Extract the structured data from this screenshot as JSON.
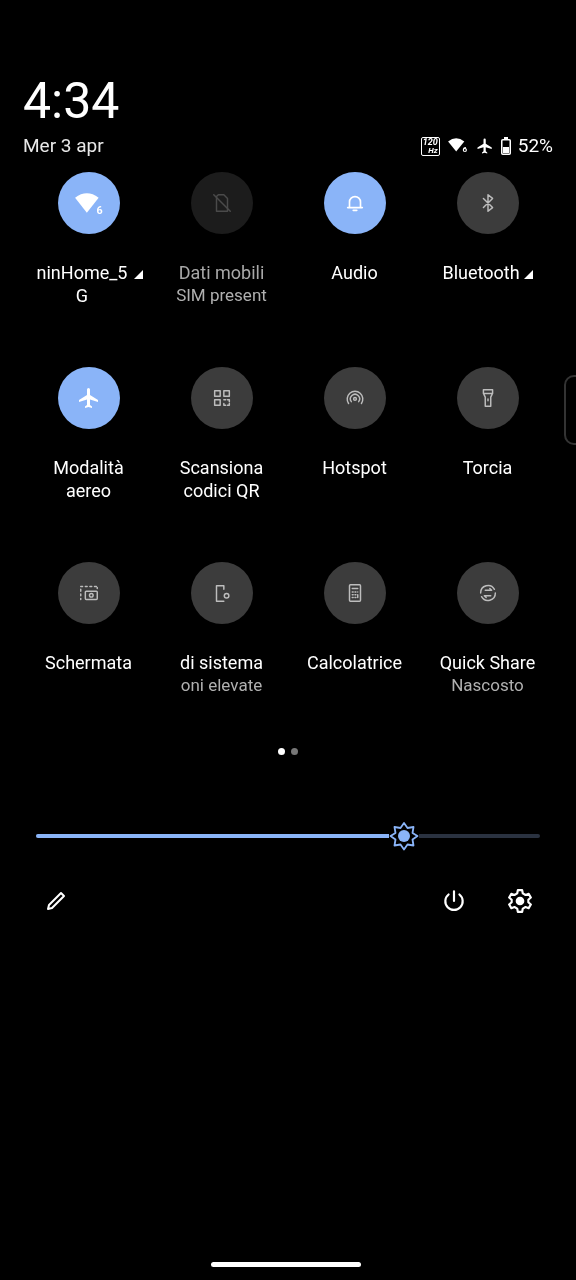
{
  "header": {
    "time": "4:34",
    "date": "Mer 3 apr"
  },
  "status_bar": {
    "refresh_rate": "120",
    "refresh_unit": "Hz",
    "wifi_badge": "6",
    "battery": "52%"
  },
  "tiles": [
    {
      "label": "ninHome_5 G",
      "on": true,
      "disabled": false,
      "badge": "6",
      "dropdown": true
    },
    {
      "label": "Dati mobili",
      "secondary": "SIM present",
      "on": false,
      "disabled": true,
      "dropdown": false
    },
    {
      "label": "Audio",
      "on": true,
      "disabled": false,
      "dropdown": false
    },
    {
      "label": "Bluetooth",
      "on": false,
      "disabled": false,
      "dropdown": true
    },
    {
      "label": "Modalità aereo",
      "on": true,
      "disabled": false,
      "dropdown": false
    },
    {
      "label": "Scansiona codici QR",
      "on": false,
      "disabled": false,
      "dropdown": false
    },
    {
      "label": "Hotspot",
      "on": false,
      "disabled": false,
      "dropdown": false
    },
    {
      "label": "Torcia",
      "on": false,
      "disabled": false,
      "dropdown": false
    },
    {
      "label": "Schermata",
      "on": false,
      "disabled": false,
      "dropdown": false
    },
    {
      "label": "di sistema",
      "secondary": "oni elevate",
      "on": false,
      "disabled": false,
      "dropdown": false
    },
    {
      "label": "Calcolatrice",
      "on": false,
      "disabled": false,
      "dropdown": false
    },
    {
      "label": "Quick Share",
      "secondary": "Nascosto",
      "on": false,
      "disabled": false,
      "dropdown": false
    }
  ],
  "pages": [
    {
      "selected": true
    },
    {
      "selected": false
    }
  ],
  "brightness": {
    "level": 0.73
  }
}
